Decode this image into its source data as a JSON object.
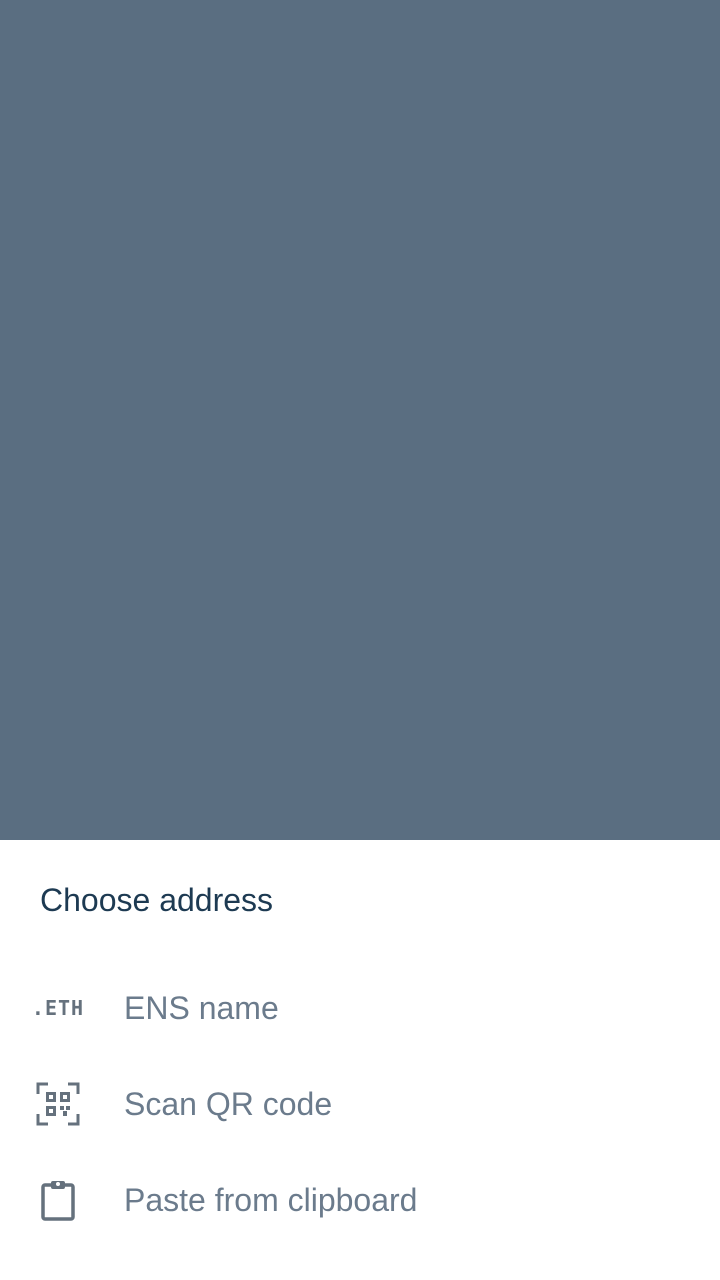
{
  "sheet": {
    "title": "Choose address",
    "options": [
      {
        "label": "ENS name",
        "icon": "eth-icon",
        "glyph": ".ETH"
      },
      {
        "label": "Scan QR code",
        "icon": "qr-code-icon"
      },
      {
        "label": "Paste from clipboard",
        "icon": "clipboard-icon"
      }
    ]
  },
  "colors": {
    "scrim": "#5a6e81",
    "sheet_bg": "#ffffff",
    "title": "#1d3a52",
    "option_text": "#6b7b8c",
    "icon": "#65717d"
  }
}
